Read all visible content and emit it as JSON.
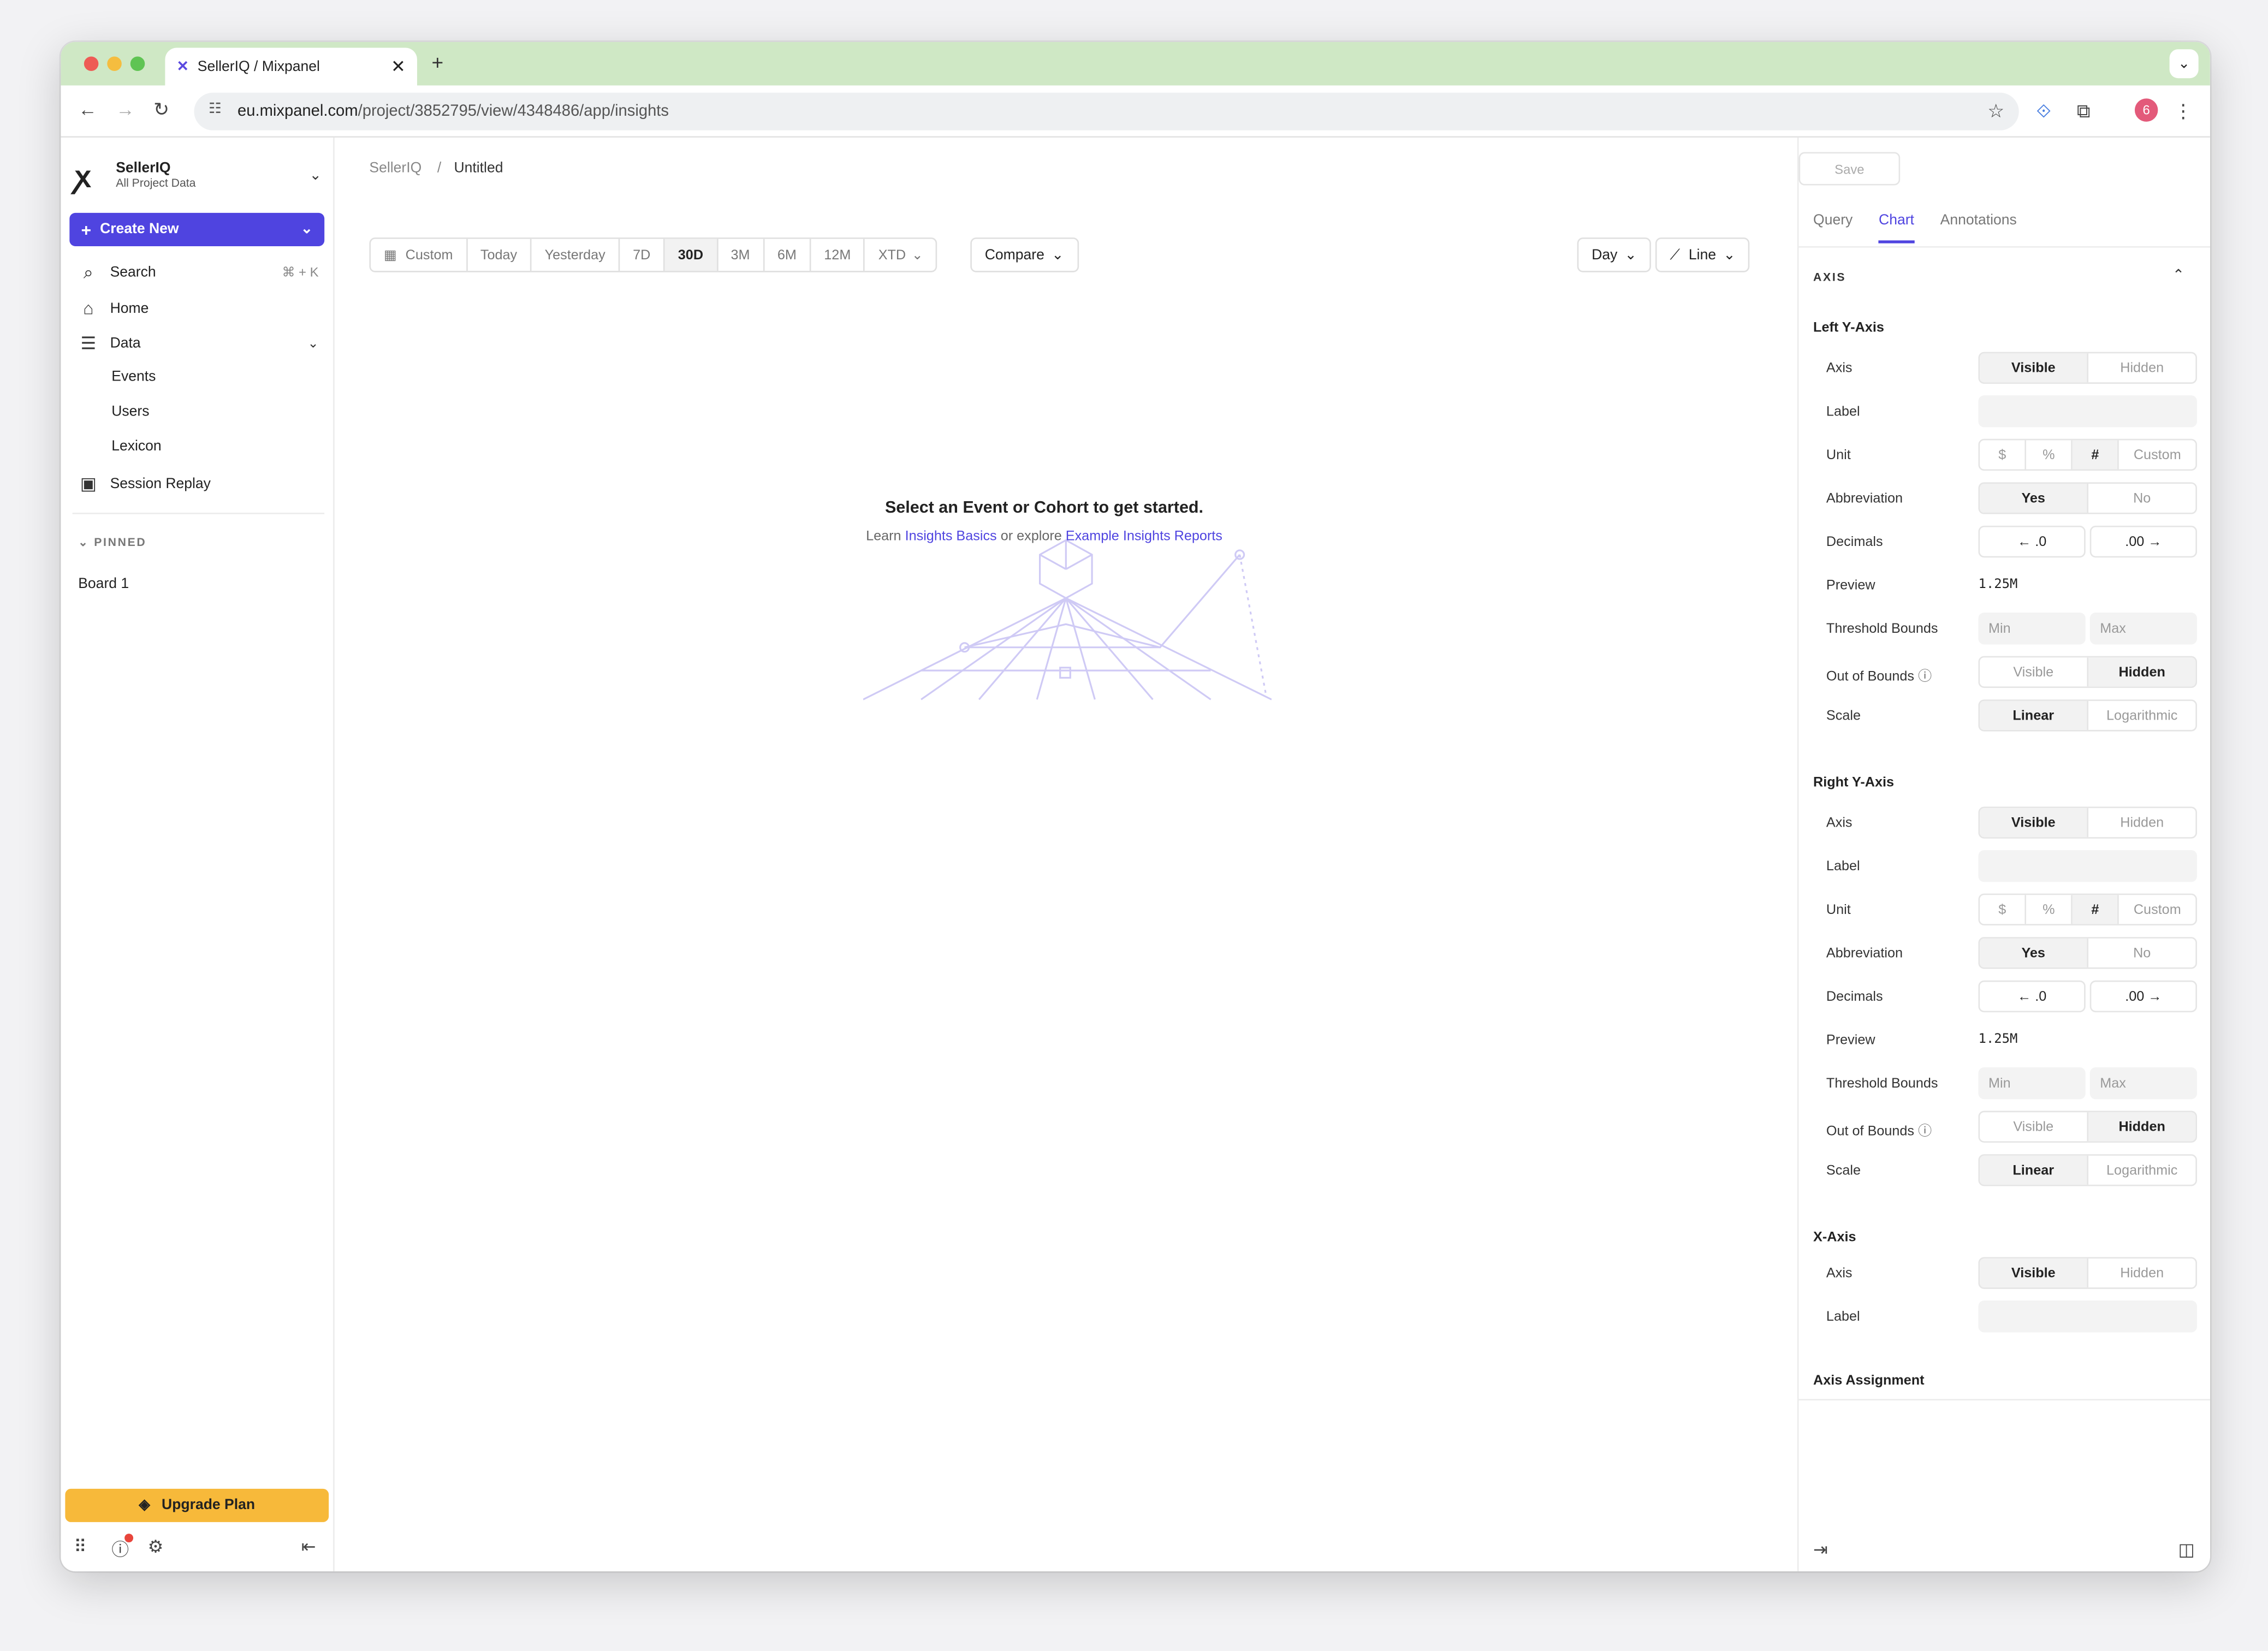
{
  "browser": {
    "tab_title": "SellerIQ / Mixpanel",
    "url_host": "eu.mixpanel.com",
    "url_path": "/project/3852795/view/4348486/app/insights",
    "profile_badge": "6"
  },
  "sidebar": {
    "project_name": "SellerIQ",
    "project_sub": "All Project Data",
    "create_new": "Create New",
    "search": "Search",
    "search_shortcut": "⌘ + K",
    "home": "Home",
    "data": "Data",
    "events": "Events",
    "users": "Users",
    "lexicon": "Lexicon",
    "session_replay": "Session Replay",
    "pinned": "PINNED",
    "board": "Board 1",
    "upgrade": "Upgrade Plan"
  },
  "main": {
    "breadcrumb_root": "SellerIQ",
    "breadcrumb_sep": "/",
    "breadcrumb_current": "Untitled",
    "save": "Save",
    "date_ranges": [
      "Custom",
      "Today",
      "Yesterday",
      "7D",
      "30D",
      "3M",
      "6M",
      "12M",
      "XTD"
    ],
    "active_range": "30D",
    "compare": "Compare",
    "granularity": "Day",
    "chart_type": "Line",
    "empty_title": "Select an Event or Cohort to get started.",
    "empty_learn": "Learn",
    "empty_link1": "Insights Basics",
    "empty_or": "or explore",
    "empty_link2": "Example Insights Reports"
  },
  "panel": {
    "tabs": [
      "Query",
      "Chart",
      "Annotations"
    ],
    "active_tab": "Chart",
    "axis_header": "AXIS",
    "left_title": "Left Y-Axis",
    "right_title": "Right Y-Axis",
    "x_title": "X-Axis",
    "assignment_title": "Axis Assignment",
    "labels": {
      "axis": "Axis",
      "label": "Label",
      "unit": "Unit",
      "abbreviation": "Abbreviation",
      "decimals": "Decimals",
      "preview": "Preview",
      "threshold": "Threshold Bounds",
      "out_of_bounds": "Out of Bounds",
      "scale": "Scale"
    },
    "options": {
      "visible": "Visible",
      "hidden": "Hidden",
      "dollar": "$",
      "percent": "%",
      "hash": "#",
      "custom": "Custom",
      "yes": "Yes",
      "no": "No",
      "dec_less": "← .0",
      "dec_more": ".00 →",
      "min": "Min",
      "max": "Max",
      "linear": "Linear",
      "logarithmic": "Logarithmic"
    },
    "preview_value": "1.25M"
  }
}
